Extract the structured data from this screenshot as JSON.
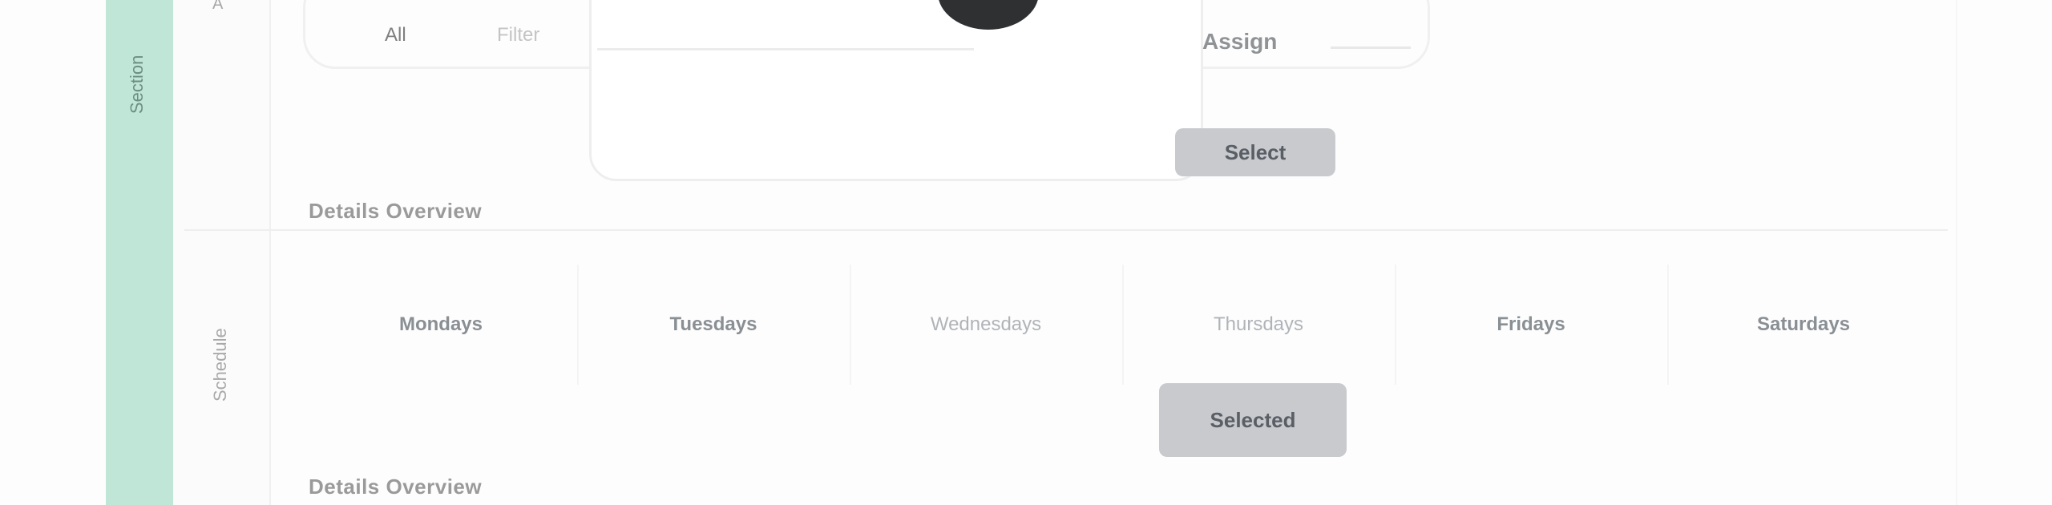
{
  "sidebar": {
    "rail_label": "Section"
  },
  "rows": {
    "top_label": "A",
    "bottom_label": "Schedule"
  },
  "top_row": {
    "tabs": [
      "All",
      "Filter"
    ],
    "side_label": "Assign",
    "chip_label": "Select",
    "section_label": "Details Overview"
  },
  "bottom_row": {
    "columns": [
      "Mondays",
      "Tuesdays",
      "Wednesdays",
      "Thursdays",
      "Fridays",
      "Saturdays"
    ],
    "chip_label": "Selected",
    "section_label": "Details Overview"
  },
  "colors": {
    "accent_green": "#bfe6d6",
    "avatar": "#2f3032",
    "chip": "#c8cace"
  }
}
